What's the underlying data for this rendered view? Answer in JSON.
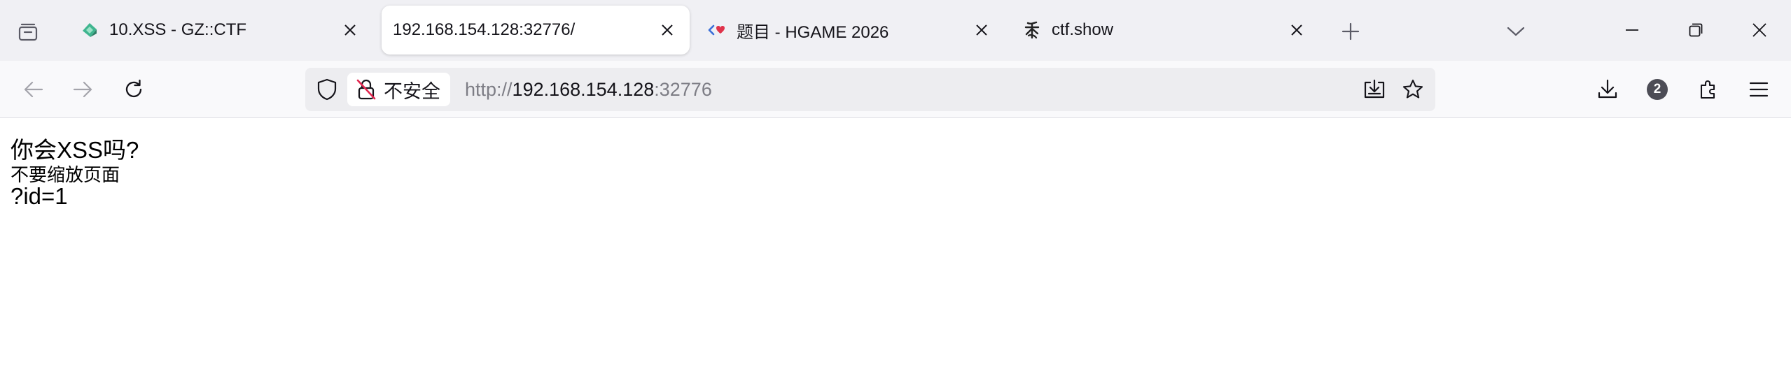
{
  "tabs": [
    {
      "title": "10.XSS - GZ::CTF",
      "icon": "gzctf-favicon-icon",
      "active": false
    },
    {
      "title": "192.168.154.128:32776/",
      "icon": "",
      "active": true
    },
    {
      "title": "题目 - HGAME 2026",
      "icon": "hgame-favicon-icon",
      "active": false
    },
    {
      "title": "ctf.show",
      "icon": "ctfshow-favicon-icon",
      "active": false
    }
  ],
  "urlbar": {
    "security_label": "不安全",
    "scheme": "http://",
    "host": "192.168.154.128",
    "port": ":32776"
  },
  "toolbar": {
    "downloads_badge": "2"
  },
  "page": {
    "line1": "你会XSS吗?",
    "line2": "不要缩放页面",
    "line3": "?id=1"
  },
  "colors": {
    "tabbar_bg": "#f0f0f4",
    "navbar_bg": "#f9f9fb",
    "urlbar_bg": "#ededf0",
    "insecure_red": "#e22850"
  }
}
